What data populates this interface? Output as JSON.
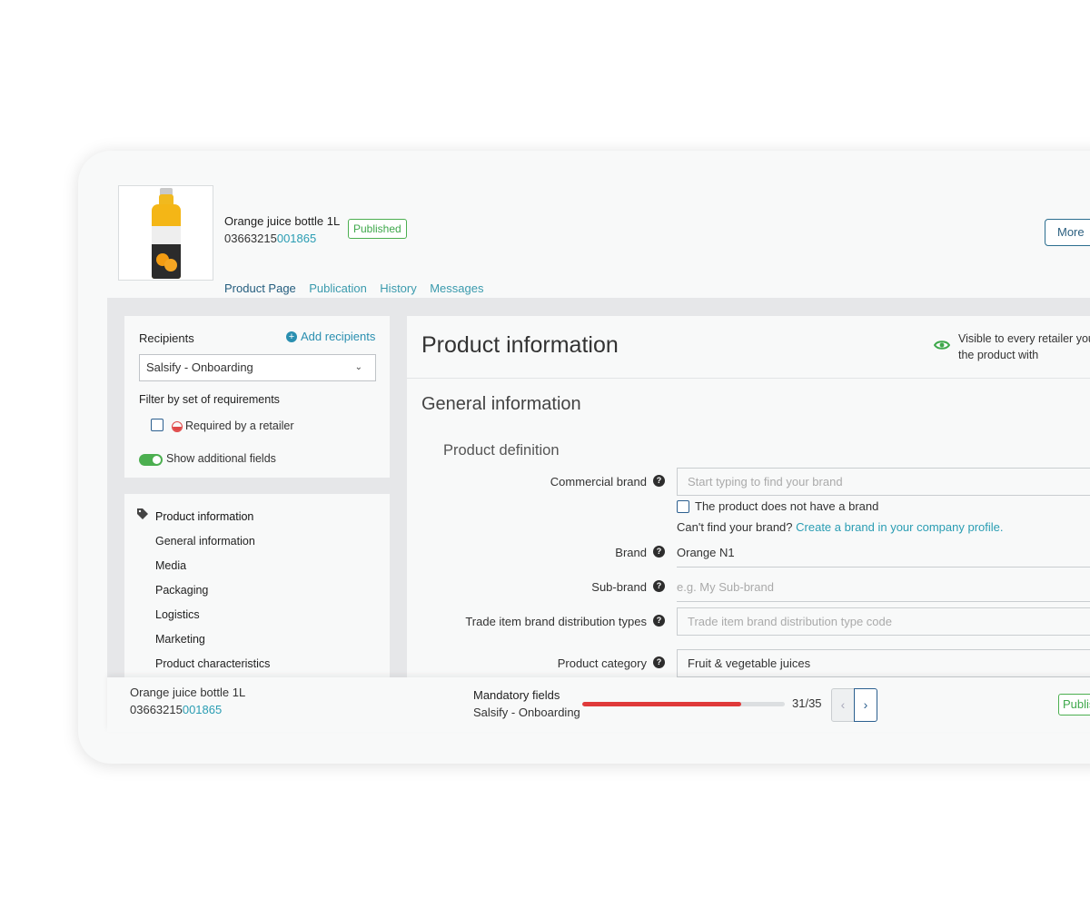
{
  "product": {
    "name": "Orange juice bottle 1L",
    "code_prefix": "03663215",
    "code_suffix": "001865",
    "status": "Published"
  },
  "header": {
    "more_label": "More"
  },
  "tabs": [
    "Product Page",
    "Publication",
    "History",
    "Messages"
  ],
  "sidebar": {
    "recipients_label": "Recipients",
    "add_recipients_label": "Add recipients",
    "recipient_selected": "Salsify - Onboarding",
    "filter_label": "Filter by set of requirements",
    "required_label": "Required by a retailer",
    "show_additional_label": "Show additional fields",
    "nav_items": [
      "Product information",
      "General information",
      "Media",
      "Packaging",
      "Logistics",
      "Marketing",
      "Product characteristics"
    ]
  },
  "main": {
    "title": "Product information",
    "visibility_text": "Visible to every retailer you share the product with",
    "section_title": "General information",
    "subsection_title": "Product definition",
    "fields": {
      "commercial_brand_label": "Commercial brand",
      "commercial_brand_placeholder": "Start typing to find your brand",
      "no_brand_label": "The product does not have a brand",
      "cant_find_text": "Can't find your brand?",
      "cant_find_link": "Create a brand in your company profile.",
      "brand_label": "Brand",
      "brand_value": "Orange N1",
      "sub_brand_label": "Sub-brand",
      "sub_brand_placeholder": "e.g. My Sub-brand",
      "distribution_label": "Trade item brand distribution types",
      "distribution_placeholder": "Trade item brand distribution type code",
      "category_label": "Product category",
      "category_value": "Fruit & vegetable juices"
    }
  },
  "footer": {
    "mandatory_label": "Mandatory fields",
    "mandatory_sub": "Salsify - Onboarding",
    "progress_done": 31,
    "progress_total": 35,
    "progress_text": "31/35",
    "publish_label": "Publish"
  },
  "colors": {
    "accent": "#2a9db3",
    "primary": "#2b5f8f",
    "success": "#4caf50",
    "danger": "#e03a3a"
  },
  "icons": [
    "plus-circle-icon",
    "chevron-down-icon",
    "required-icon",
    "tag-icon",
    "eye-icon",
    "help-icon",
    "chevron-left-icon",
    "chevron-right-icon"
  ]
}
